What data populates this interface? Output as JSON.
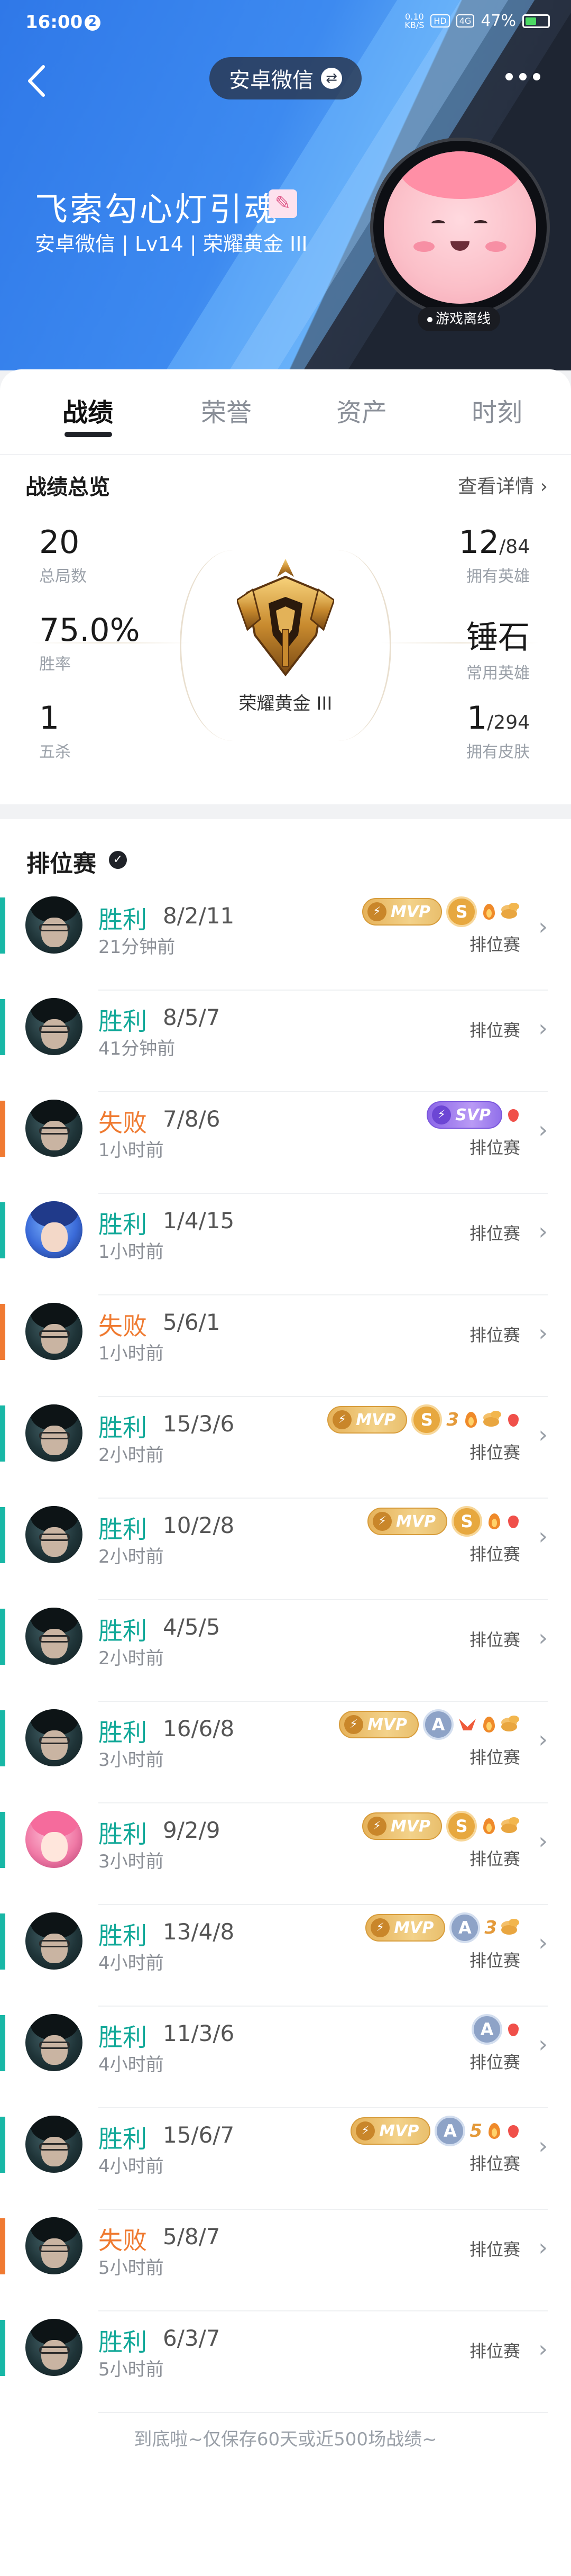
{
  "status_bar": {
    "time": "16:00",
    "notif_badge": "2",
    "speed_top": "0.10",
    "speed_bottom": "KB/S",
    "net_chip": "HD",
    "net_type": "4G",
    "battery": "47%",
    "battery_color": "#4cd964"
  },
  "header": {
    "account_label": "安卓微信",
    "swap_icon": "⇄",
    "nickname": "飞索勾心灯引魂",
    "edit_icon": "✎",
    "meta": "安卓微信 | Lv14 | 荣耀黄金 III",
    "status": "游戏离线"
  },
  "tabs": [
    {
      "label": "战绩",
      "active": true
    },
    {
      "label": "荣誉",
      "active": false
    },
    {
      "label": "资产",
      "active": false
    },
    {
      "label": "时刻",
      "active": false
    }
  ],
  "overview": {
    "title": "战绩总览",
    "view_detail": "查看详情",
    "total_games": {
      "value": "20",
      "label": "总局数"
    },
    "heroes": {
      "value": "12",
      "total": "/84",
      "label": "拥有英雄"
    },
    "win_rate": {
      "value": "75.0%",
      "label": "胜率"
    },
    "common_hero": {
      "value": "锤石",
      "label": "常用英雄"
    },
    "pentakill": {
      "value": "1",
      "label": "五杀"
    },
    "skins": {
      "value": "1",
      "total": "/294",
      "label": "拥有皮肤"
    },
    "rank": "荣耀黄金 III"
  },
  "matches": {
    "title": "排位赛",
    "mode_label": "排位赛",
    "colors": {
      "win": "#12a898",
      "loss": "#ef7a30"
    },
    "rows": [
      {
        "result": "胜利",
        "win": true,
        "kda": "8/2/11",
        "time": "21分钟前",
        "avatar": "teal",
        "badges": [
          "mvp",
          "S",
          "fire",
          "coin"
        ]
      },
      {
        "result": "胜利",
        "win": true,
        "kda": "8/5/7",
        "time": "41分钟前",
        "avatar": "teal",
        "badges": []
      },
      {
        "result": "失败",
        "win": false,
        "kda": "7/8/6",
        "time": "1小时前",
        "avatar": "teal",
        "badges": [
          "svp",
          "drop"
        ]
      },
      {
        "result": "胜利",
        "win": true,
        "kda": "1/4/15",
        "time": "1小时前",
        "avatar": "blue",
        "badges": []
      },
      {
        "result": "失败",
        "win": false,
        "kda": "5/6/1",
        "time": "1小时前",
        "avatar": "teal",
        "badges": []
      },
      {
        "result": "胜利",
        "win": true,
        "kda": "15/3/6",
        "time": "2小时前",
        "avatar": "teal",
        "badges": [
          "mvp",
          "S",
          "num:3",
          "fire",
          "coin",
          "drop"
        ]
      },
      {
        "result": "胜利",
        "win": true,
        "kda": "10/2/8",
        "time": "2小时前",
        "avatar": "teal",
        "badges": [
          "mvp",
          "S",
          "fire",
          "drop"
        ]
      },
      {
        "result": "胜利",
        "win": true,
        "kda": "4/5/5",
        "time": "2小时前",
        "avatar": "teal",
        "badges": []
      },
      {
        "result": "胜利",
        "win": true,
        "kda": "16/6/8",
        "time": "3小时前",
        "avatar": "teal",
        "badges": [
          "mvp",
          "A",
          "wing",
          "fire",
          "coin"
        ]
      },
      {
        "result": "胜利",
        "win": true,
        "kda": "9/2/9",
        "time": "3小时前",
        "avatar": "pink",
        "badges": [
          "mvp",
          "S",
          "fire",
          "coin"
        ]
      },
      {
        "result": "胜利",
        "win": true,
        "kda": "13/4/8",
        "time": "4小时前",
        "avatar": "teal",
        "badges": [
          "mvp",
          "A",
          "num:3",
          "coin"
        ]
      },
      {
        "result": "胜利",
        "win": true,
        "kda": "11/3/6",
        "time": "4小时前",
        "avatar": "teal",
        "badges": [
          "A",
          "drop"
        ]
      },
      {
        "result": "胜利",
        "win": true,
        "kda": "15/6/7",
        "time": "4小时前",
        "avatar": "teal",
        "badges": [
          "mvp",
          "A",
          "num:5",
          "fire",
          "drop"
        ]
      },
      {
        "result": "失败",
        "win": false,
        "kda": "5/8/7",
        "time": "5小时前",
        "avatar": "teal",
        "badges": []
      },
      {
        "result": "胜利",
        "win": true,
        "kda": "6/3/7",
        "time": "5小时前",
        "avatar": "teal",
        "badges": []
      }
    ],
    "mvp_text": "MVP",
    "svp_text": "SVP",
    "bolt": "⚡",
    "chevron": "›"
  },
  "footer": "到底啦~仅保存60天或近500场战绩~"
}
